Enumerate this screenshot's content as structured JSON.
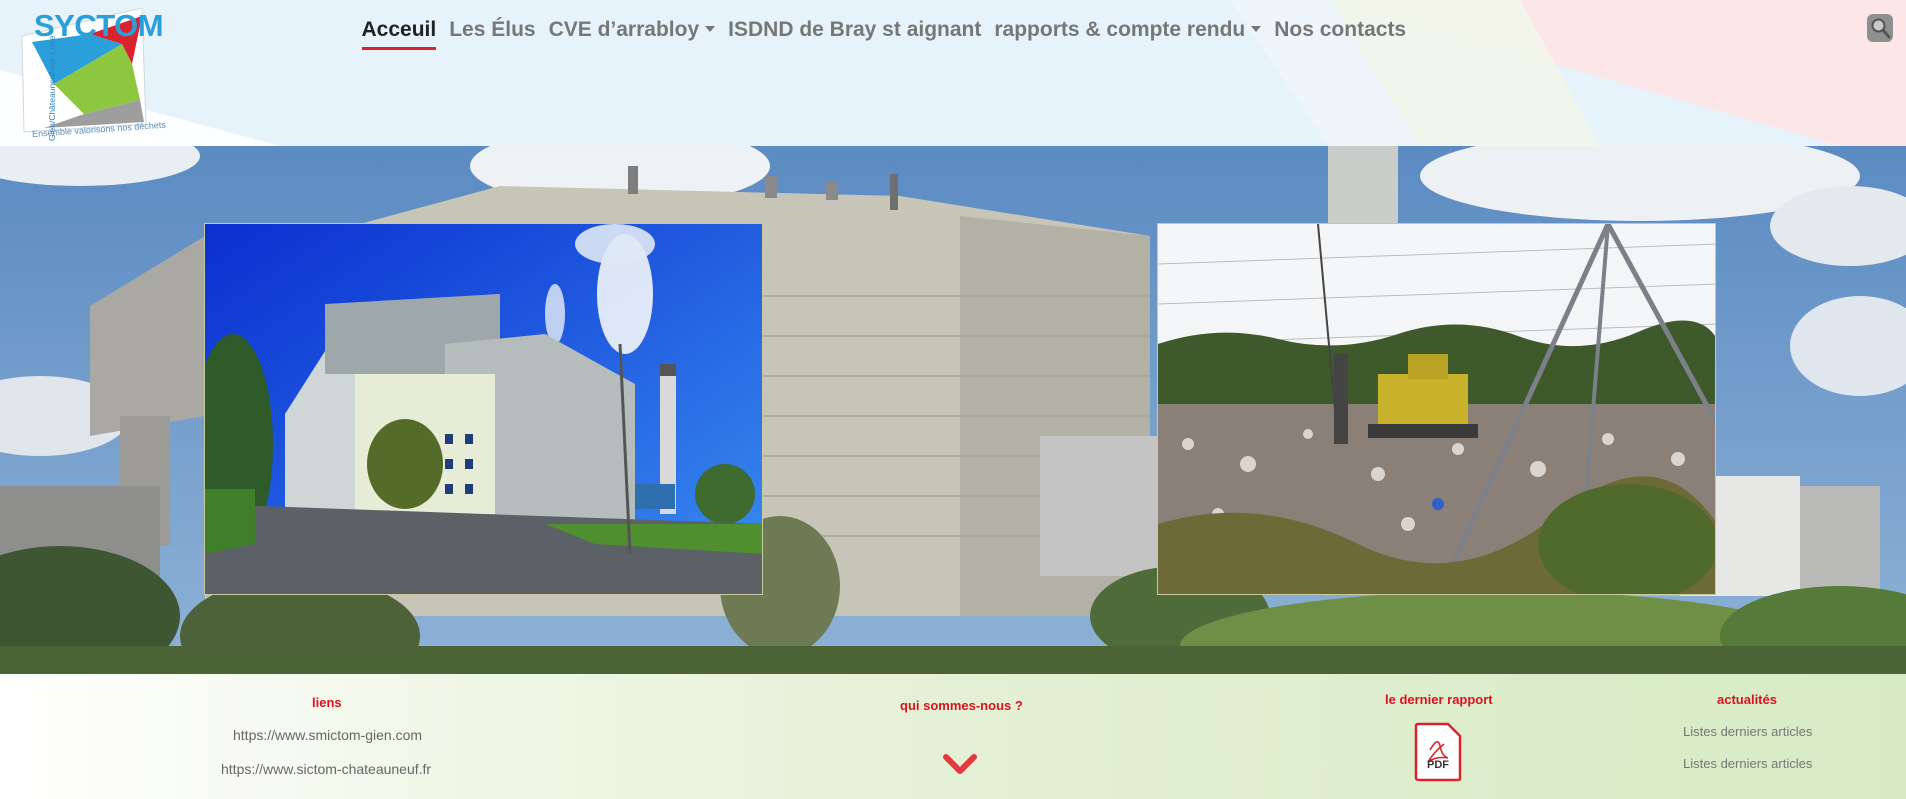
{
  "brand": {
    "logo_text": "SYCTOM",
    "logo_vertical": "Gien/Châteauneuf-sur-Loire",
    "tagline": "Ensemble valorisons nos déchets"
  },
  "nav": {
    "items": [
      {
        "label": "Acceuil",
        "active": true,
        "dropdown": false
      },
      {
        "label": "Les Élus",
        "active": false,
        "dropdown": false
      },
      {
        "label": "CVE d’arrabloy",
        "active": false,
        "dropdown": true
      },
      {
        "label": "ISDND de Bray st aignant",
        "active": false,
        "dropdown": false
      },
      {
        "label": "rapports & compte rendu",
        "active": false,
        "dropdown": true
      },
      {
        "label": "Nos contacts",
        "active": false,
        "dropdown": false
      }
    ],
    "search_icon": "search-icon"
  },
  "footer": {
    "liens": {
      "title": "liens",
      "links": [
        "https://www.smictom-gien.com",
        "https://www.sictom-chateauneuf.fr"
      ]
    },
    "about": {
      "title": "qui sommes-nous ?",
      "icon": "chevron-down-icon"
    },
    "report": {
      "title": "le dernier rapport",
      "icon": "pdf-icon",
      "icon_label": "PDF"
    },
    "news": {
      "title": "actualités",
      "items": [
        "Listes derniers articles",
        "Listes derniers articles"
      ]
    }
  },
  "colors": {
    "accent": "#d6141e",
    "header_bg": "#e7f3fb",
    "footer_bg": "#d8eac5"
  }
}
